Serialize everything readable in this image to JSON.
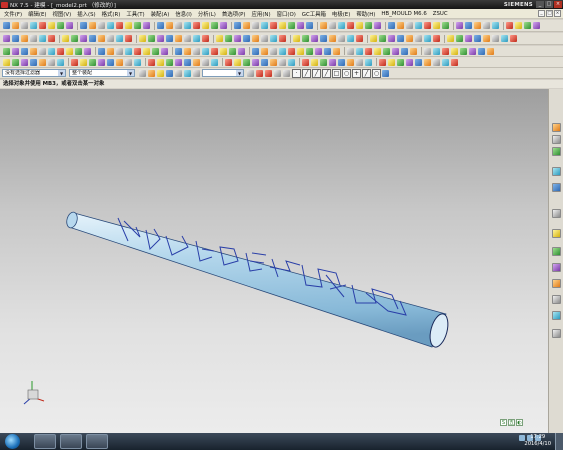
{
  "window": {
    "title": "NX 7.5 - 建模 - [_model2.prt （修改的）]",
    "brand": "SIEMENS",
    "controls": [
      "_",
      "□",
      "×"
    ]
  },
  "menubar": {
    "items": [
      "文件(F)",
      "编辑(E)",
      "视图(V)",
      "插入(S)",
      "格式(R)",
      "工具(T)",
      "装配(A)",
      "信息(I)",
      "分析(L)",
      "首选项(P)",
      "应用(N)",
      "窗口(O)",
      "GC工具箱",
      "电极(E)",
      "帮助(H)",
      "HB_MOULD M6.6",
      "ZSUC"
    ]
  },
  "selection_bar": {
    "filter_value": "没有选择过滤器",
    "assembly_value": "整个装配",
    "snap_value": ""
  },
  "cue_line": "选择对象并使用 MB3，或者双击某一对象",
  "model": {
    "text": "NX7.5 ZSUC",
    "body_color": "#a9cfe6",
    "edge_color": "#2a3fa8"
  },
  "taskbar": {
    "time": "17:29",
    "date": "2016/4/10",
    "ime_labels": [
      "S",
      "五",
      "◐"
    ]
  },
  "resource_bar": {
    "icons": [
      "assembly-navigator-icon",
      "constraint-navigator-icon",
      "part-navigator-icon",
      "reuse-library-icon",
      "web-browser-icon",
      "history-icon",
      "system-materials-icon",
      "process-studio-icon",
      "manufacturing-wizards-icon",
      "roles-icon",
      "system-scenes-icon",
      "palette-icon",
      "tools-icon"
    ]
  }
}
